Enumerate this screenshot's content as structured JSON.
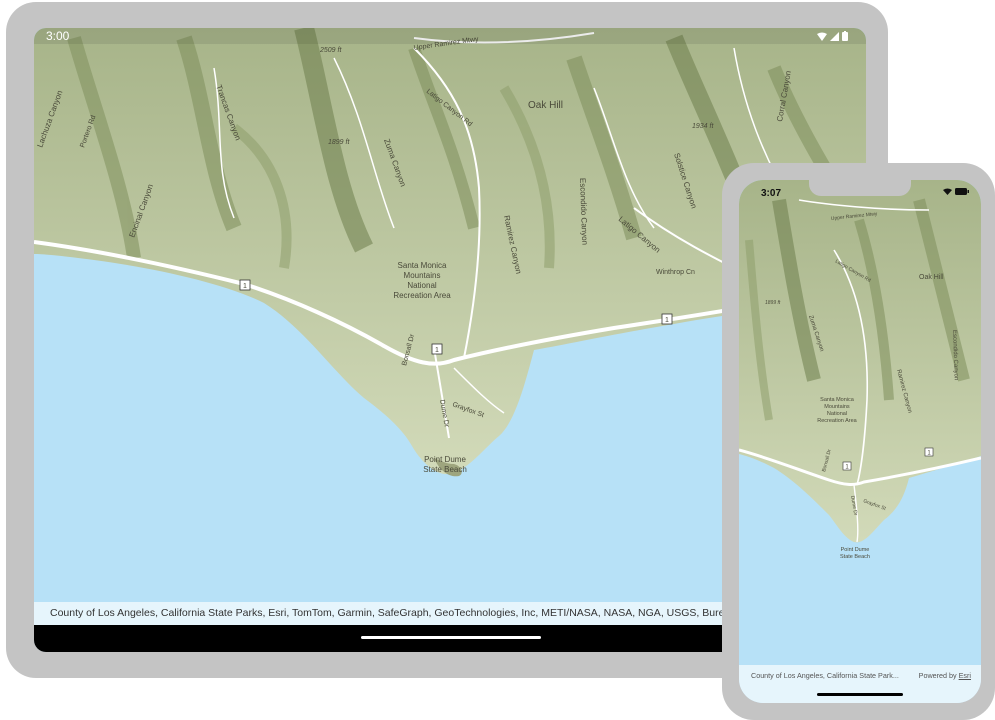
{
  "tablet": {
    "status_time": "3:00",
    "attribution": "County of Los Angeles, California State Parks, Esri, TomTom, Garmin, SafeGraph, GeoTechnologies, Inc, METI/NASA, NASA, NGA, USGS, Bureau of Land Mana",
    "map_labels": {
      "oak_hill": "Oak Hill",
      "elev_2509": "2509 ft",
      "elev_1899": "1899 ft",
      "elev_1934": "1934 ft",
      "upper_ramirez": "Upper Ramirez Mtwy",
      "latigo_canyon_rd": "Latigo Canyon Rd",
      "lachuza_canyon": "Lachuza Canyon",
      "encinal_canyon": "Encinal Canyon",
      "trancas_canyon": "Trancas Canyon",
      "zuma_canyon": "Zuma Canyon",
      "ramirez_canyon": "Ramirez Canyon",
      "escondido_canyon": "Escondido Canyon",
      "solstice_canyon": "Solstice Canyon",
      "latigo_canyon": "Latigo Canyon",
      "corral_canyon": "Corral Canyon",
      "santa_monica_1": "Santa Monica",
      "santa_monica_2": "Mountains",
      "santa_monica_3": "National",
      "santa_monica_4": "Recreation Area",
      "bonsall_dr": "Bonsall Dr",
      "dume_dr": "Dume Dr",
      "grayfox_st": "Grayfox St",
      "point_dume_1": "Point Dume",
      "point_dume_2": "State Beach",
      "route_1": "1",
      "winthrop": "Winthrop Cn",
      "portero_rd": "Portero Rd"
    }
  },
  "phone": {
    "status_time": "3:07",
    "attribution_left": "County of Los Angeles, California State Park...",
    "powered_by": "Powered by ",
    "esri": "Esri",
    "map_labels": {
      "oak_hill": "Oak Hill",
      "upper_ramirez": "Upper Ramirez Mtwy",
      "latigo_canyon_rd": "Latigo Canyon Rd",
      "zuma_canyon": "Zuma Canyon",
      "ramirez_canyon": "Ramirez Canyon",
      "escondido_canyon": "Escondido Canyon",
      "santa_monica_1": "Santa Monica",
      "santa_monica_2": "Mountains",
      "santa_monica_3": "National",
      "santa_monica_4": "Recreation Area",
      "bonsall_dr": "Bonsall Dr",
      "dume_dr": "Dume Dr",
      "grayfox_st": "Grayfox St",
      "point_dume_1": "Point Dume",
      "point_dume_2": "State Beach",
      "route_1": "1",
      "elev": "1899 ft"
    }
  },
  "colors": {
    "ocean": "#b7e1f7",
    "land": "#c9d3ae",
    "terrain_dark": "#8f9f6c",
    "road": "#ffffff",
    "device_frame": "#c4c4c4",
    "attribution_bg": "#e6f5fc"
  }
}
